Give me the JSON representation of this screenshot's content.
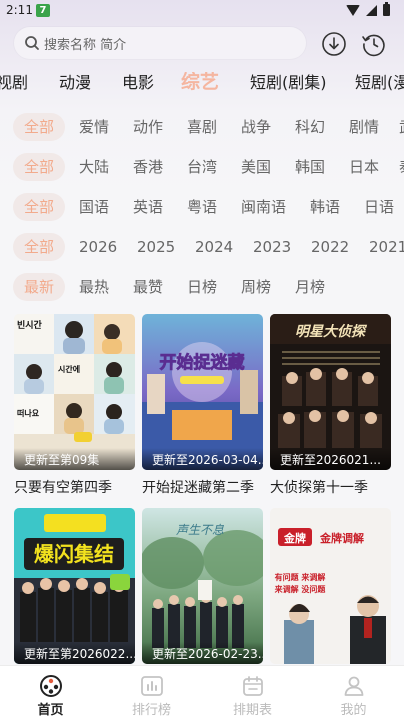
{
  "status": {
    "time": "2:11",
    "badge": "7"
  },
  "search": {
    "placeholder": "搜索名称 简介"
  },
  "category_tabs": [
    {
      "label": "视剧",
      "active": false
    },
    {
      "label": "动漫",
      "active": false
    },
    {
      "label": "电影",
      "active": false
    },
    {
      "label": "综艺",
      "active": true
    },
    {
      "label": "短剧(剧集)",
      "active": false
    },
    {
      "label": "短剧(漫",
      "active": false
    }
  ],
  "filters": [
    {
      "selected": "全部",
      "options": [
        "爱情",
        "动作",
        "喜剧",
        "战争",
        "科幻",
        "剧情",
        "武"
      ]
    },
    {
      "selected": "全部",
      "options": [
        "大陆",
        "香港",
        "台湾",
        "美国",
        "韩国",
        "日本",
        "泰"
      ]
    },
    {
      "selected": "全部",
      "options": [
        "国语",
        "英语",
        "粤语",
        "闽南语",
        "韩语",
        "日语",
        "法"
      ]
    },
    {
      "selected": "全部",
      "options": [
        "2026",
        "2025",
        "2024",
        "2023",
        "2022",
        "2021"
      ]
    },
    {
      "selected": "最新",
      "options": [
        "最热",
        "最赞",
        "日榜",
        "周榜",
        "月榜"
      ]
    }
  ],
  "cards": [
    {
      "title": "只要有空第四季",
      "caption": "更新至第09集"
    },
    {
      "title": "开始捉迷藏第二季",
      "caption": "更新至2026-03-04..."
    },
    {
      "title": "大侦探第十一季",
      "caption": "更新至2026021..."
    },
    {
      "title": "",
      "caption": "更新至第2026022..."
    },
    {
      "title": "",
      "caption": "更新至2026-02-23..."
    },
    {
      "title": "",
      "caption": ""
    }
  ],
  "poster_text": {
    "p2_logo": "开始捉迷藏",
    "p3_logo": "明星大侦探",
    "p4_logo": "爆闪集结",
    "p6_logo": "金牌调解",
    "p6_line1": "有问题 来调解",
    "p6_line2": "来调解 没问题"
  },
  "nav": [
    {
      "label": "首页",
      "icon": "film-reel-icon",
      "active": true
    },
    {
      "label": "排行榜",
      "icon": "bar-chart-icon",
      "active": false
    },
    {
      "label": "排期表",
      "icon": "calendar-icon",
      "active": false
    },
    {
      "label": "我的",
      "icon": "user-icon",
      "active": false
    }
  ],
  "colors": {
    "accent": "#f2aa8c",
    "accent_bg": "#f1e9e8",
    "text": "#222222",
    "muted": "#666666"
  }
}
